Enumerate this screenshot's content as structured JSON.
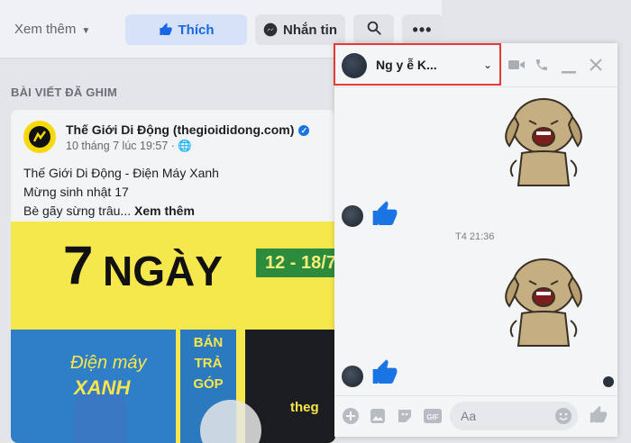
{
  "toolbar": {
    "more_label": "Xem thêm",
    "like_label": "Thích",
    "message_label": "Nhắn tin"
  },
  "feed": {
    "pinned_title": "BÀI VIẾT ĐÃ GHIM",
    "post": {
      "page_name": "Thế Giới Di Động (thegioididong.com)",
      "time": "10 tháng 7 lúc 19:57 ·",
      "line1": "Thế Giới Di Động - Điện Máy Xanh",
      "line2": "Mừng sinh nhật 17",
      "line3": "Bè gãy sừng trâu...",
      "see_more": "Xem thêm",
      "banner": {
        "big_number": "7",
        "big_word": "NGÀY",
        "dates": "12 - 18/7",
        "brand_top": "Điện máy",
        "brand_bottom": "XANH",
        "bta1": "BÁN",
        "bta2": "TRẢ",
        "bta3": "GÓP",
        "dark_text": "theg"
      }
    }
  },
  "chat": {
    "contact_name": "Ng   y ễ     K...",
    "timestamp": "T4 21:36",
    "composer_placeholder": "Aa"
  },
  "colors": {
    "accent": "#1b74e4",
    "highlight_border": "#e53935"
  }
}
